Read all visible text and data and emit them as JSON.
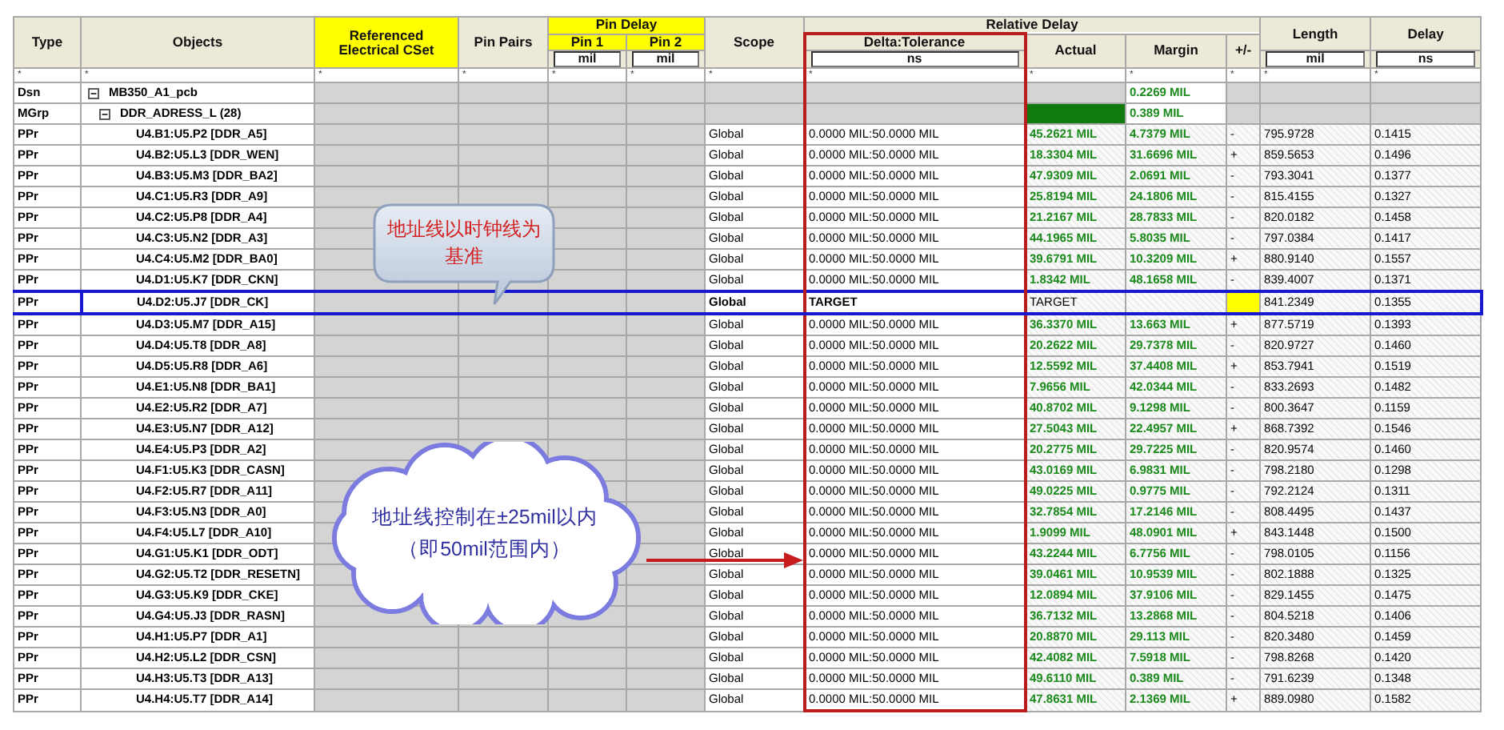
{
  "header": {
    "type": "Type",
    "objects": "Objects",
    "ref_cset": "Referenced Electrical CSet",
    "pin_pairs": "Pin Pairs",
    "pin_delay": {
      "title": "Pin Delay",
      "pin1": "Pin 1",
      "pin1_unit": "mil",
      "pin2": "Pin 2",
      "pin2_unit": "mil"
    },
    "scope": "Scope",
    "relative_delay": {
      "title": "Relative Delay",
      "delta": "Delta:Tolerance",
      "delta_unit": "ns",
      "actual": "Actual",
      "margin": "Margin",
      "sign": "+/-"
    },
    "length": "Length",
    "length_unit": "mil",
    "delay": "Delay",
    "delay_unit": "ns"
  },
  "filter_row": [
    "*",
    "*",
    "*",
    "*",
    "*",
    "*",
    "*",
    "*",
    "*",
    "*",
    "*",
    "*",
    "*"
  ],
  "rows": [
    {
      "kind": "group",
      "type": "Dsn",
      "object": "MB350_A1_pcb",
      "expanded": true,
      "actual_flag": false,
      "margin": "0.2269 MIL",
      "children": [
        {
          "kind": "group",
          "type": "MGrp",
          "object": "DDR_ADRESS_L (28)",
          "expanded": true,
          "actual_flag": true,
          "margin": "0.389 MIL",
          "children": [
            {
              "kind": "pinpair",
              "type": "PPr",
              "object": "U4.B1:U5.P2 [DDR_A5]",
              "scope": "Global",
              "delta": "0.0000 MIL:50.0000 MIL",
              "actual": "45.2621 MIL",
              "margin": "4.7379 MIL",
              "sign": "-",
              "length": "795.9728",
              "delay": "0.1415",
              "target": false
            },
            {
              "kind": "pinpair",
              "type": "PPr",
              "object": "U4.B2:U5.L3 [DDR_WEN]",
              "scope": "Global",
              "delta": "0.0000 MIL:50.0000 MIL",
              "actual": "18.3304 MIL",
              "margin": "31.6696 MIL",
              "sign": "+",
              "length": "859.5653",
              "delay": "0.1496",
              "target": false
            },
            {
              "kind": "pinpair",
              "type": "PPr",
              "object": "U4.B3:U5.M3 [DDR_BA2]",
              "scope": "Global",
              "delta": "0.0000 MIL:50.0000 MIL",
              "actual": "47.9309 MIL",
              "margin": "2.0691 MIL",
              "sign": "-",
              "length": "793.3041",
              "delay": "0.1377",
              "target": false
            },
            {
              "kind": "pinpair",
              "type": "PPr",
              "object": "U4.C1:U5.R3 [DDR_A9]",
              "scope": "Global",
              "delta": "0.0000 MIL:50.0000 MIL",
              "actual": "25.8194 MIL",
              "margin": "24.1806 MIL",
              "sign": "-",
              "length": "815.4155",
              "delay": "0.1327",
              "target": false
            },
            {
              "kind": "pinpair",
              "type": "PPr",
              "object": "U4.C2:U5.P8 [DDR_A4]",
              "scope": "Global",
              "delta": "0.0000 MIL:50.0000 MIL",
              "actual": "21.2167 MIL",
              "margin": "28.7833 MIL",
              "sign": "-",
              "length": "820.0182",
              "delay": "0.1458",
              "target": false
            },
            {
              "kind": "pinpair",
              "type": "PPr",
              "object": "U4.C3:U5.N2 [DDR_A3]",
              "scope": "Global",
              "delta": "0.0000 MIL:50.0000 MIL",
              "actual": "44.1965 MIL",
              "margin": "5.8035 MIL",
              "sign": "-",
              "length": "797.0384",
              "delay": "0.1417",
              "target": false
            },
            {
              "kind": "pinpair",
              "type": "PPr",
              "object": "U4.C4:U5.M2 [DDR_BA0]",
              "scope": "Global",
              "delta": "0.0000 MIL:50.0000 MIL",
              "actual": "39.6791 MIL",
              "margin": "10.3209 MIL",
              "sign": "+",
              "length": "880.9140",
              "delay": "0.1557",
              "target": false
            },
            {
              "kind": "pinpair",
              "type": "PPr",
              "object": "U4.D1:U5.K7 [DDR_CKN]",
              "scope": "Global",
              "delta": "0.0000 MIL:50.0000 MIL",
              "actual": "1.8342 MIL",
              "margin": "48.1658 MIL",
              "sign": "-",
              "length": "839.4007",
              "delay": "0.1371",
              "target": false
            },
            {
              "kind": "pinpair",
              "type": "PPr",
              "object": "U4.D2:U5.J7 [DDR_CK]",
              "scope": "Global",
              "delta": "TARGET",
              "actual": "TARGET",
              "length": "841.2349",
              "delay": "0.1355",
              "target": true
            },
            {
              "kind": "pinpair",
              "type": "PPr",
              "object": "U4.D3:U5.M7 [DDR_A15]",
              "scope": "Global",
              "delta": "0.0000 MIL:50.0000 MIL",
              "actual": "36.3370 MIL",
              "margin": "13.663 MIL",
              "sign": "+",
              "length": "877.5719",
              "delay": "0.1393",
              "target": false
            },
            {
              "kind": "pinpair",
              "type": "PPr",
              "object": "U4.D4:U5.T8 [DDR_A8]",
              "scope": "Global",
              "delta": "0.0000 MIL:50.0000 MIL",
              "actual": "20.2622 MIL",
              "margin": "29.7378 MIL",
              "sign": "-",
              "length": "820.9727",
              "delay": "0.1460",
              "target": false
            },
            {
              "kind": "pinpair",
              "type": "PPr",
              "object": "U4.D5:U5.R8 [DDR_A6]",
              "scope": "Global",
              "delta": "0.0000 MIL:50.0000 MIL",
              "actual": "12.5592 MIL",
              "margin": "37.4408 MIL",
              "sign": "+",
              "length": "853.7941",
              "delay": "0.1519",
              "target": false
            },
            {
              "kind": "pinpair",
              "type": "PPr",
              "object": "U4.E1:U5.N8 [DDR_BA1]",
              "scope": "Global",
              "delta": "0.0000 MIL:50.0000 MIL",
              "actual": "7.9656 MIL",
              "margin": "42.0344 MIL",
              "sign": "-",
              "length": "833.2693",
              "delay": "0.1482",
              "target": false
            },
            {
              "kind": "pinpair",
              "type": "PPr",
              "object": "U4.E2:U5.R2 [DDR_A7]",
              "scope": "Global",
              "delta": "0.0000 MIL:50.0000 MIL",
              "actual": "40.8702 MIL",
              "margin": "9.1298 MIL",
              "sign": "-",
              "length": "800.3647",
              "delay": "0.1159",
              "target": false
            },
            {
              "kind": "pinpair",
              "type": "PPr",
              "object": "U4.E3:U5.N7 [DDR_A12]",
              "scope": "Global",
              "delta": "0.0000 MIL:50.0000 MIL",
              "actual": "27.5043 MIL",
              "margin": "22.4957 MIL",
              "sign": "+",
              "length": "868.7392",
              "delay": "0.1546",
              "target": false
            },
            {
              "kind": "pinpair",
              "type": "PPr",
              "object": "U4.E4:U5.P3 [DDR_A2]",
              "scope": "Global",
              "delta": "0.0000 MIL:50.0000 MIL",
              "actual": "20.2775 MIL",
              "margin": "29.7225 MIL",
              "sign": "-",
              "length": "820.9574",
              "delay": "0.1460",
              "target": false
            },
            {
              "kind": "pinpair",
              "type": "PPr",
              "object": "U4.F1:U5.K3 [DDR_CASN]",
              "scope": "Global",
              "delta": "0.0000 MIL:50.0000 MIL",
              "actual": "43.0169 MIL",
              "margin": "6.9831 MIL",
              "sign": "-",
              "length": "798.2180",
              "delay": "0.1298",
              "target": false
            },
            {
              "kind": "pinpair",
              "type": "PPr",
              "object": "U4.F2:U5.R7 [DDR_A11]",
              "scope": "Global",
              "delta": "0.0000 MIL:50.0000 MIL",
              "actual": "49.0225 MIL",
              "margin": "0.9775 MIL",
              "sign": "-",
              "length": "792.2124",
              "delay": "0.1311",
              "target": false
            },
            {
              "kind": "pinpair",
              "type": "PPr",
              "object": "U4.F3:U5.N3 [DDR_A0]",
              "scope": "Global",
              "delta": "0.0000 MIL:50.0000 MIL",
              "actual": "32.7854 MIL",
              "margin": "17.2146 MIL",
              "sign": "-",
              "length": "808.4495",
              "delay": "0.1437",
              "target": false
            },
            {
              "kind": "pinpair",
              "type": "PPr",
              "object": "U4.F4:U5.L7 [DDR_A10]",
              "scope": "Global",
              "delta": "0.0000 MIL:50.0000 MIL",
              "actual": "1.9099 MIL",
              "margin": "48.0901 MIL",
              "sign": "+",
              "length": "843.1448",
              "delay": "0.1500",
              "target": false
            },
            {
              "kind": "pinpair",
              "type": "PPr",
              "object": "U4.G1:U5.K1 [DDR_ODT]",
              "scope": "Global",
              "delta": "0.0000 MIL:50.0000 MIL",
              "actual": "43.2244 MIL",
              "margin": "6.7756 MIL",
              "sign": "-",
              "length": "798.0105",
              "delay": "0.1156",
              "target": false
            },
            {
              "kind": "pinpair",
              "type": "PPr",
              "object": "U4.G2:U5.T2 [DDR_RESETN]",
              "scope": "Global",
              "delta": "0.0000 MIL:50.0000 MIL",
              "actual": "39.0461 MIL",
              "margin": "10.9539 MIL",
              "sign": "-",
              "length": "802.1888",
              "delay": "0.1325",
              "target": false
            },
            {
              "kind": "pinpair",
              "type": "PPr",
              "object": "U4.G3:U5.K9 [DDR_CKE]",
              "scope": "Global",
              "delta": "0.0000 MIL:50.0000 MIL",
              "actual": "12.0894 MIL",
              "margin": "37.9106 MIL",
              "sign": "-",
              "length": "829.1455",
              "delay": "0.1475",
              "target": false
            },
            {
              "kind": "pinpair",
              "type": "PPr",
              "object": "U4.G4:U5.J3 [DDR_RASN]",
              "scope": "Global",
              "delta": "0.0000 MIL:50.0000 MIL",
              "actual": "36.7132 MIL",
              "margin": "13.2868 MIL",
              "sign": "-",
              "length": "804.5218",
              "delay": "0.1406",
              "target": false
            },
            {
              "kind": "pinpair",
              "type": "PPr",
              "object": "U4.H1:U5.P7 [DDR_A1]",
              "scope": "Global",
              "delta": "0.0000 MIL:50.0000 MIL",
              "actual": "20.8870 MIL",
              "margin": "29.113 MIL",
              "sign": "-",
              "length": "820.3480",
              "delay": "0.1459",
              "target": false
            },
            {
              "kind": "pinpair",
              "type": "PPr",
              "object": "U4.H2:U5.L2 [DDR_CSN]",
              "scope": "Global",
              "delta": "0.0000 MIL:50.0000 MIL",
              "actual": "42.4082 MIL",
              "margin": "7.5918 MIL",
              "sign": "-",
              "length": "798.8268",
              "delay": "0.1420",
              "target": false
            },
            {
              "kind": "pinpair",
              "type": "PPr",
              "object": "U4.H3:U5.T3 [DDR_A13]",
              "scope": "Global",
              "delta": "0.0000 MIL:50.0000 MIL",
              "actual": "49.6110 MIL",
              "margin": "0.389 MIL",
              "sign": "-",
              "length": "791.6239",
              "delay": "0.1348",
              "target": false
            },
            {
              "kind": "pinpair",
              "type": "PPr",
              "object": "U4.H4:U5.T7 [DDR_A14]",
              "scope": "Global",
              "delta": "0.0000 MIL:50.0000 MIL",
              "actual": "47.8631 MIL",
              "margin": "2.1369 MIL",
              "sign": "+",
              "length": "889.0980",
              "delay": "0.1582",
              "target": false
            }
          ]
        }
      ]
    }
  ],
  "annotations": [
    {
      "kind": "bubble",
      "text": "地址线以时钟线为基准"
    },
    {
      "kind": "cloud",
      "text": "地址线控制在±25mil以内（即50mil范围内）"
    }
  ]
}
